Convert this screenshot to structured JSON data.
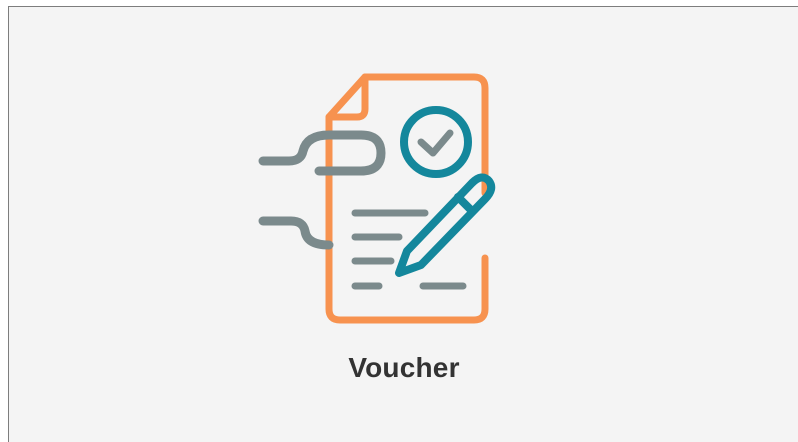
{
  "tile": {
    "label": "Voucher",
    "icon": "voucher-document-icon"
  },
  "colors": {
    "document_outline": "#f7924f",
    "check_circle": "#14879c",
    "check_mark": "#7b8a8c",
    "lines": "#7b8a8c",
    "paperclip": "#7b8a8c",
    "pen": "#14879c",
    "background": "#f4f4f4",
    "label_text": "#333333"
  }
}
